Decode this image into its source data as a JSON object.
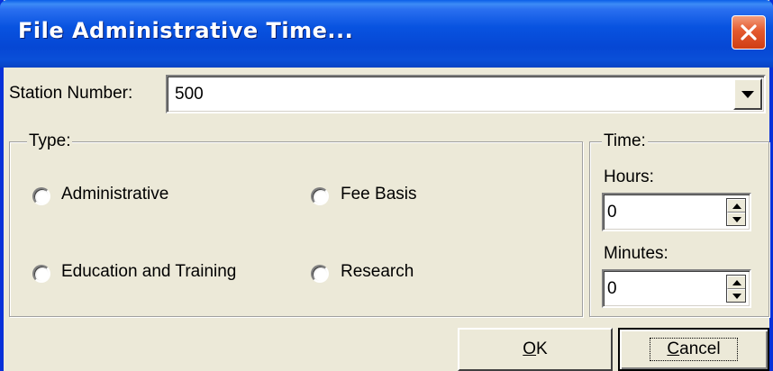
{
  "window": {
    "title": "File Administrative Time...",
    "close_icon": "close-icon"
  },
  "station": {
    "label": "Station Number:",
    "value": "500",
    "dropdown_icon": "chevron-down-icon"
  },
  "type_group": {
    "caption": "Type:",
    "options": [
      {
        "label": "Administrative",
        "selected": false
      },
      {
        "label": "Fee Basis",
        "selected": false
      },
      {
        "label": "Education and Training",
        "selected": false
      },
      {
        "label": "Research",
        "selected": false
      }
    ]
  },
  "time_group": {
    "caption": "Time:",
    "hours_label": "Hours:",
    "hours_value": "0",
    "minutes_label": "Minutes:",
    "minutes_value": "0"
  },
  "buttons": {
    "ok_mnemonic": "O",
    "ok_rest": "K",
    "cancel_mnemonic": "C",
    "cancel_rest": "ancel"
  },
  "colors": {
    "titlebar": "#0853e0",
    "close": "#e45a2f",
    "face": "#ece9d8"
  }
}
